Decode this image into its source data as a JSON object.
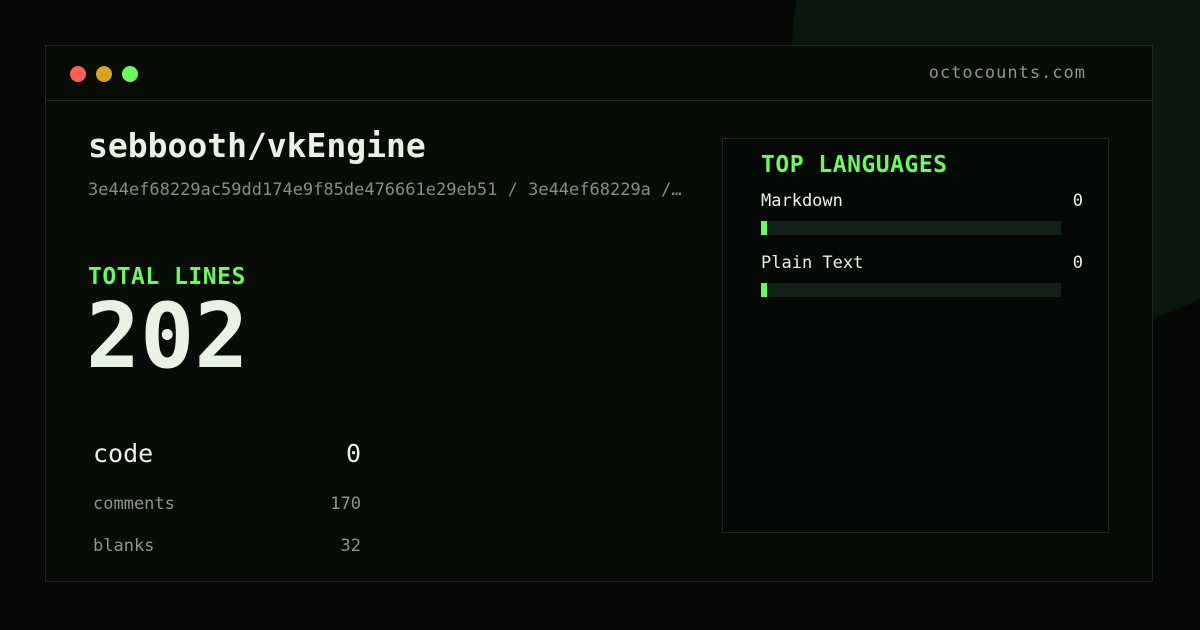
{
  "window": {
    "domain": "octocounts.com",
    "traffic_lights": [
      "#ff5f56",
      "#d9a22a",
      "#6cf95f"
    ]
  },
  "repo": {
    "title": "sebbooth/vkEngine",
    "commit": "3e44ef68229ac59dd174e9f85de476661e29eb51 / 3e44ef68229a /…"
  },
  "totals": {
    "label": "TOTAL LINES",
    "value": "202",
    "code": {
      "label": "code",
      "value": "0"
    },
    "comments": {
      "label": "comments",
      "value": "170"
    },
    "blanks": {
      "label": "blanks",
      "value": "32"
    }
  },
  "languages": {
    "title": "TOP LANGUAGES",
    "items": [
      {
        "name": "Markdown",
        "count": "0",
        "fraction": 0
      },
      {
        "name": "Plain Text",
        "count": "0",
        "fraction": 0
      }
    ]
  },
  "colors": {
    "accent": "#6cf95f",
    "text": "#e8f3e3",
    "muted": "#838f85",
    "background": "#050805"
  }
}
